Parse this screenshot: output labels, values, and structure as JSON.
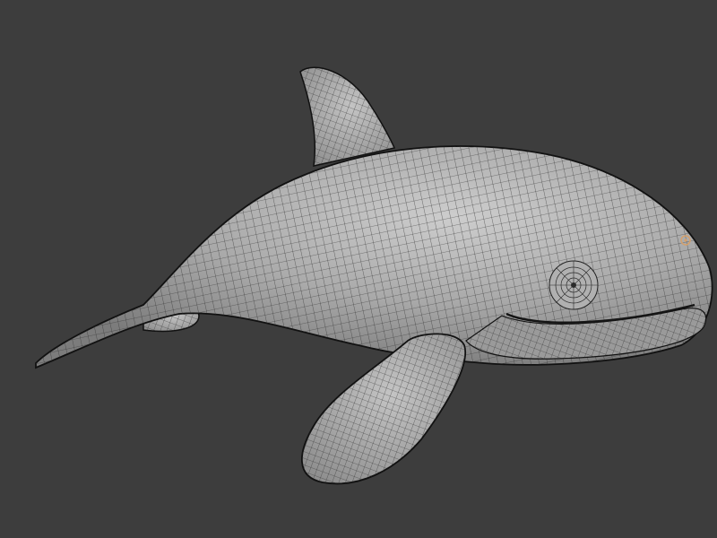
{
  "viewport": {
    "background_color": "#3d3d3d",
    "mesh_fill_color": "#a4a4a4",
    "mesh_highlight_color": "#c9c9c9",
    "wire_color": "#2b2b2b",
    "outline_color": "#111111",
    "origin_marker_color": "#d6a06a"
  },
  "model": {
    "icon": "whale-mesh-icon",
    "shading": "solid-with-wireframe-overlay"
  }
}
